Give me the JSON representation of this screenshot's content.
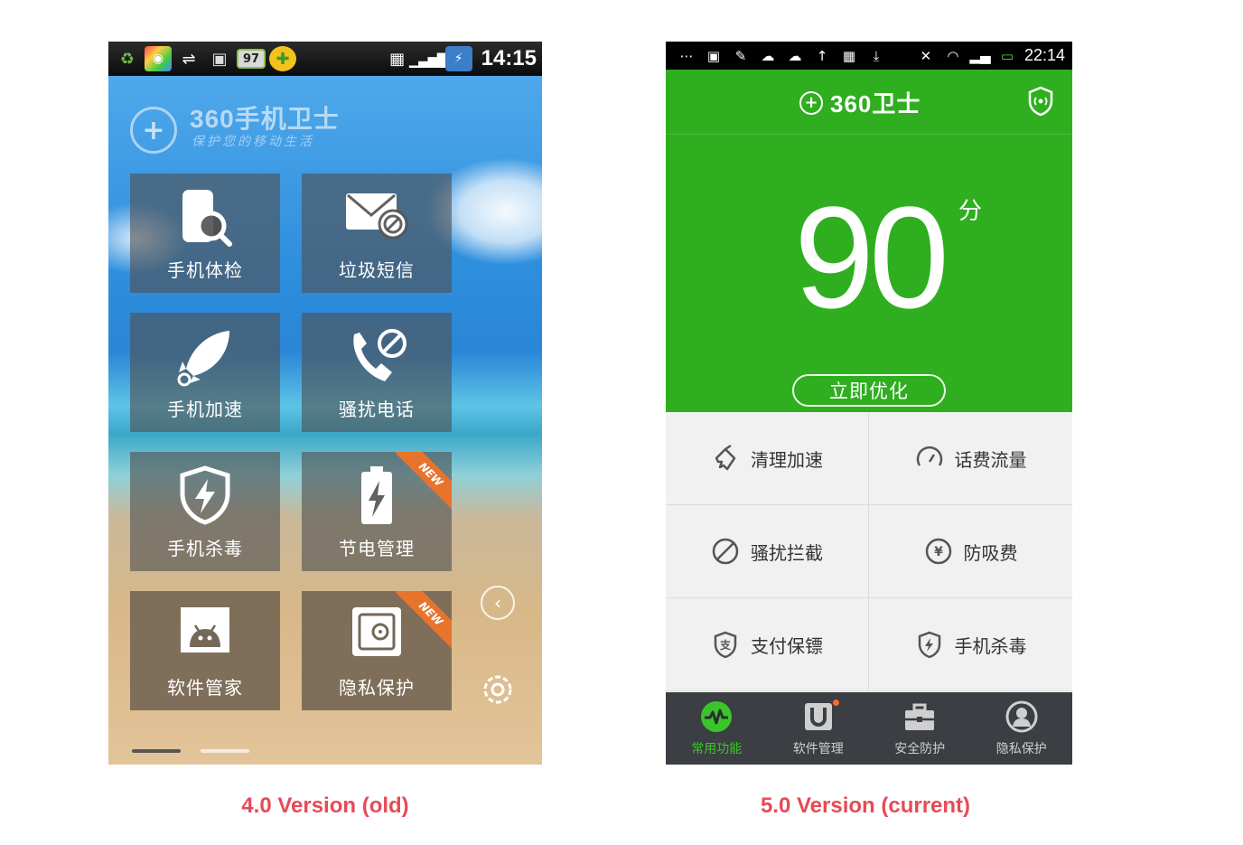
{
  "old_version": {
    "status": {
      "battery": "97",
      "time": "14:15"
    },
    "logo": {
      "title": "360手机卫士",
      "subtitle": "保护您的移动生活"
    },
    "tiles": [
      {
        "label": "手机体检",
        "icon": "phone-search-icon",
        "badge": ""
      },
      {
        "label": "垃圾短信",
        "icon": "mail-block-icon",
        "badge": ""
      },
      {
        "label": "手机加速",
        "icon": "rocket-icon",
        "badge": ""
      },
      {
        "label": "骚扰电话",
        "icon": "phone-block-icon",
        "badge": ""
      },
      {
        "label": "手机杀毒",
        "icon": "shield-bolt-icon",
        "badge": ""
      },
      {
        "label": "节电管理",
        "icon": "battery-bolt-icon",
        "badge": "NEW"
      },
      {
        "label": "软件管家",
        "icon": "android-icon",
        "badge": ""
      },
      {
        "label": "隐私保护",
        "icon": "safe-icon",
        "badge": "NEW"
      }
    ],
    "caption": "4.0 Version (old)"
  },
  "new_version": {
    "status": {
      "time": "22:14"
    },
    "brand": "360卫士",
    "score": "90",
    "score_unit": "分",
    "optimize_button": "立即优化",
    "features": [
      {
        "label": "清理加速",
        "icon": "broom-icon"
      },
      {
        "label": "话费流量",
        "icon": "gauge-icon"
      },
      {
        "label": "骚扰拦截",
        "icon": "block-icon"
      },
      {
        "label": "防吸费",
        "icon": "yen-icon"
      },
      {
        "label": "支付保镖",
        "icon": "pay-shield-icon"
      },
      {
        "label": "手机杀毒",
        "icon": "bolt-shield-icon"
      }
    ],
    "tabs": [
      {
        "label": "常用功能",
        "icon": "pulse-icon",
        "active": true
      },
      {
        "label": "软件管理",
        "icon": "magnet-icon",
        "active": false
      },
      {
        "label": "安全防护",
        "icon": "toolbox-icon",
        "active": false
      },
      {
        "label": "隐私保护",
        "icon": "person-icon",
        "active": false
      }
    ],
    "caption": "5.0 Version (current)"
  },
  "colors": {
    "brand_green": "#2fae1f",
    "tab_active": "#3cc52a",
    "caption": "#e84a55",
    "new_badge": "#e8732d"
  }
}
